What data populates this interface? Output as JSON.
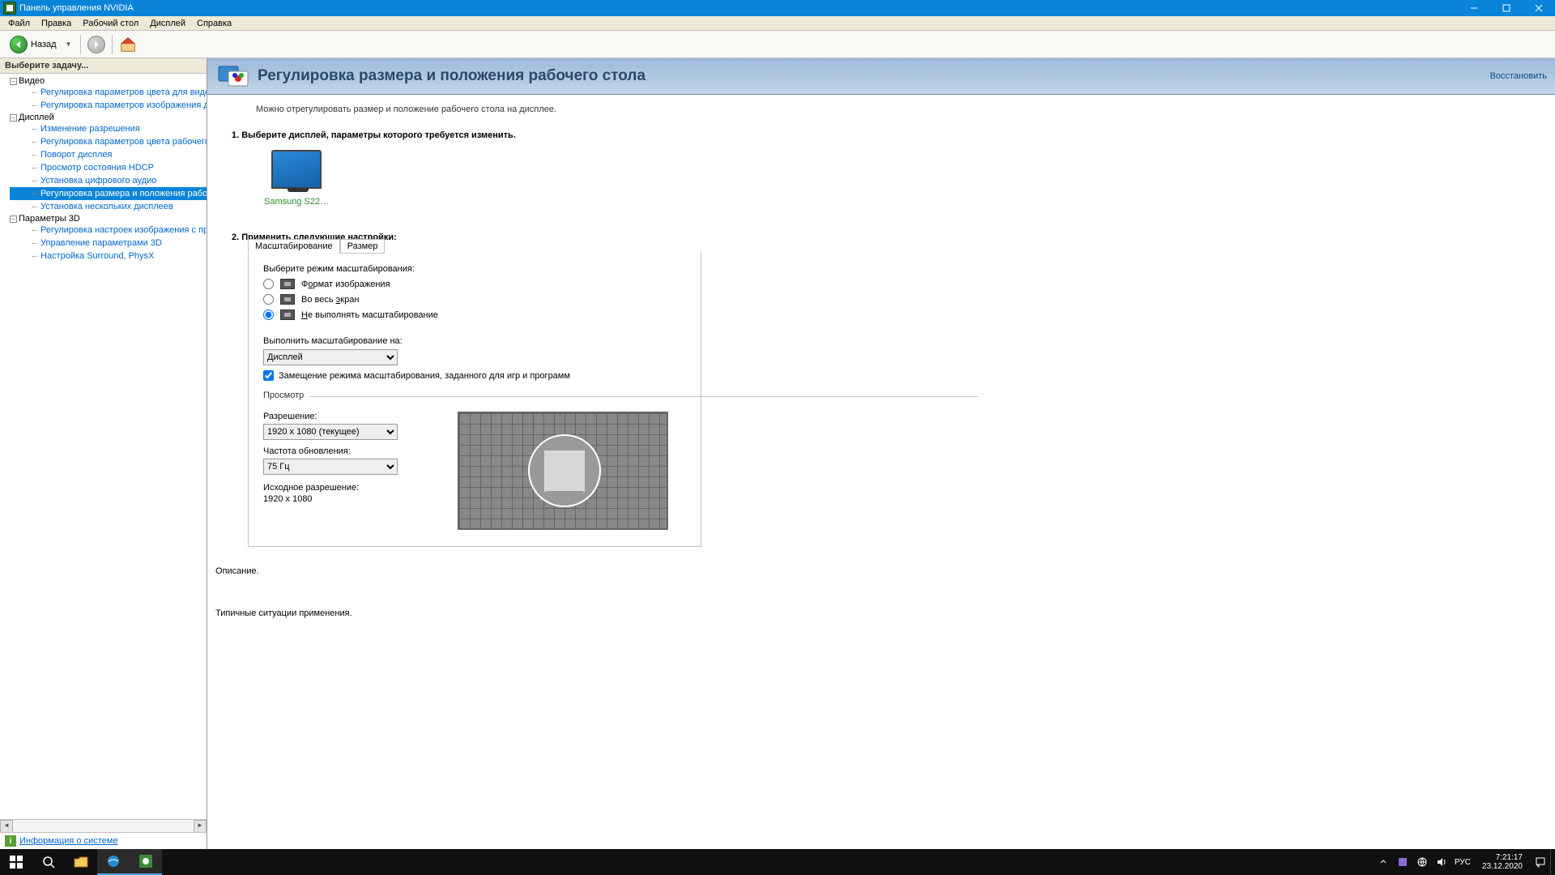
{
  "titlebar": {
    "title": "Панель управления NVIDIA"
  },
  "menubar": [
    "Файл",
    "Правка",
    "Рабочий стол",
    "Дисплей",
    "Справка"
  ],
  "toolbar": {
    "back": "Назад"
  },
  "sidebar": {
    "header": "Выберите задачу...",
    "groups": [
      {
        "label": "Видео",
        "items": [
          "Регулировка параметров цвета для видео",
          "Регулировка параметров изображения для видео"
        ]
      },
      {
        "label": "Дисплей",
        "items": [
          "Изменение разрешения",
          "Регулировка параметров цвета рабочего стола",
          "Поворот дисплея",
          "Просмотр состояния HDCP",
          "Установка цифрового аудио",
          "Регулировка размера и положения рабочего стола",
          "Установка нескольких дисплеев"
        ],
        "selectedIndex": 5
      },
      {
        "label": "Параметры 3D",
        "items": [
          "Регулировка настроек изображения с просмотром",
          "Управление параметрами 3D",
          "Настройка Surround, PhysX"
        ]
      }
    ],
    "footer": "Информация о системе"
  },
  "page": {
    "title": "Регулировка размера и положения рабочего стола",
    "restore": "Восстановить",
    "desc": "Можно отрегулировать размер и положение рабочего стола на дисплее.",
    "step1": "1. Выберите дисплей, параметры которого требуется изменить.",
    "display_name": "Samsung S22…",
    "step2": "2. Применить следующие настройки:",
    "tabs": {
      "scaling": "Масштабирование",
      "size": "Размер"
    },
    "scaling": {
      "mode_label": "Выберите режим масштабирования:",
      "opt_aspect_pre": "Ф",
      "opt_aspect_u": "о",
      "opt_aspect_post": "рмат изображения",
      "opt_full_pre": "Во весь ",
      "opt_full_u": "э",
      "opt_full_post": "кран",
      "opt_none_u": "Н",
      "opt_none_post": "е выполнять масштабирование",
      "perform_on_label": "Выполнить масштабирование на:",
      "perform_on_value": "Дисплей",
      "override": "Замещение режима масштабирования, заданного для игр и программ",
      "preview": "Просмотр",
      "res_label": "Разрешение:",
      "res_value": "1920 x 1080 (текущее)",
      "refresh_label": "Частота обновления:",
      "refresh_value": "75 Гц",
      "native_label": "Исходное разрешение:",
      "native_value": "1920 x 1080"
    },
    "desc_heading": "Описание.",
    "usage_heading": "Типичные ситуации применения."
  },
  "taskbar": {
    "lang": "РУС",
    "time": "7:21:17",
    "date": "23.12.2020"
  }
}
